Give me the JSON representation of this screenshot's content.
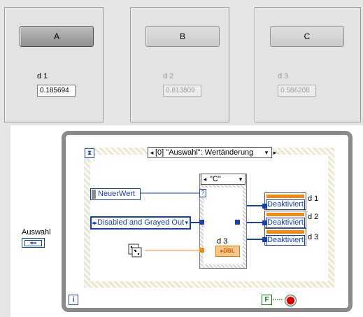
{
  "front_panel": {
    "buttons": [
      {
        "label": "A",
        "enabled": true
      },
      {
        "label": "B",
        "enabled": false
      },
      {
        "label": "C",
        "enabled": false
      }
    ],
    "indicators": [
      {
        "label": "d 1",
        "value": "0.185694",
        "enabled": true
      },
      {
        "label": "d 2",
        "value": "0.813809",
        "enabled": false
      },
      {
        "label": "d 3",
        "value": "0.586208",
        "enabled": false
      }
    ]
  },
  "auswahl_control": {
    "label": "Auswahl",
    "glyph": "◂▸▸"
  },
  "diagram": {
    "event_selector": "[0] \"Auswahl\": Wertänderung",
    "case_selector": "\"C\"",
    "newvalue_label": "NeuerWert",
    "ring_value": "Disabled and Grayed Out",
    "property_value": "Deaktiviert",
    "property_tags": [
      "d 1",
      "d 2",
      "d 3"
    ],
    "case_indicator_label": "d 3",
    "dbl_label": "DBL",
    "iteration_glyph": "i",
    "false_const": "F",
    "unknown_glyph": "?"
  },
  "colors": {
    "wire_enum": "#1a3fa8",
    "wire_double": "#f08a14",
    "boolean": "#0b7a0b",
    "stop": "#d40000"
  }
}
